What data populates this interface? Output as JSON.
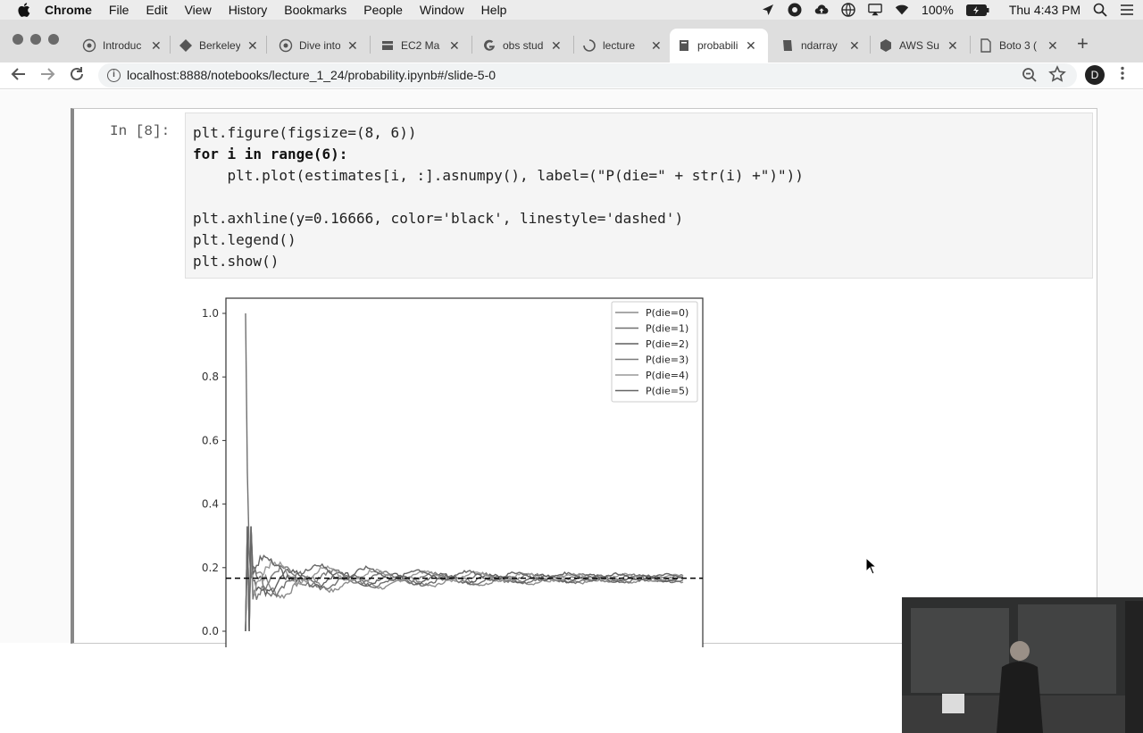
{
  "menubar": {
    "app_name": "Chrome",
    "items": [
      "File",
      "Edit",
      "View",
      "History",
      "Bookmarks",
      "People",
      "Window",
      "Help"
    ],
    "battery": "100%",
    "clock": "Thu 4:43 PM"
  },
  "tabs": [
    {
      "title": "Introduc",
      "icon": "globe-icon"
    },
    {
      "title": "Berkeley",
      "icon": "tag-icon"
    },
    {
      "title": "Dive into",
      "icon": "globe-icon"
    },
    {
      "title": "EC2 Ma",
      "icon": "box-icon"
    },
    {
      "title": "obs stud",
      "icon": "google-icon"
    },
    {
      "title": "lecture",
      "icon": "loading-icon"
    },
    {
      "title": "probabili",
      "icon": "notebook-icon",
      "active": true
    },
    {
      "title": "ndarray",
      "icon": "book-icon"
    },
    {
      "title": "AWS Su",
      "icon": "box-icon"
    },
    {
      "title": "Boto 3 (",
      "icon": "doc-icon"
    }
  ],
  "address": {
    "url": "localhost:8888/notebooks/lecture_1_24/probability.ipynb#/slide-5-0",
    "profile_initial": "D"
  },
  "cell": {
    "prompt": "In [8]:",
    "code": [
      "plt.figure(figsize=(8, 6))",
      "for i in range(6):",
      "    plt.plot(estimates[i, :].asnumpy(), label=(\"P(die=\" + str(i) +\")\"))",
      "",
      "plt.axhline(y=0.16666, color='black', linestyle='dashed')",
      "plt.legend()",
      "plt.show()"
    ]
  },
  "chart_data": {
    "type": "line",
    "ylim": [
      0.0,
      1.0
    ],
    "yticks": [
      "0.0",
      "0.2",
      "0.4",
      "0.6",
      "0.8",
      "1.0"
    ],
    "legend_position": "top-right",
    "series": [
      {
        "name": "P(die=0)",
        "color": "#8c8c8c"
      },
      {
        "name": "P(die=1)",
        "color": "#707070"
      },
      {
        "name": "P(die=2)",
        "color": "#5f5f5f"
      },
      {
        "name": "P(die=3)",
        "color": "#7a7a7a"
      },
      {
        "name": "P(die=4)",
        "color": "#999999"
      },
      {
        "name": "P(die=5)",
        "color": "#656565"
      }
    ],
    "reference_line": {
      "y": 0.16666,
      "style": "dashed",
      "color": "#000000"
    },
    "converge_to": 0.1667
  }
}
